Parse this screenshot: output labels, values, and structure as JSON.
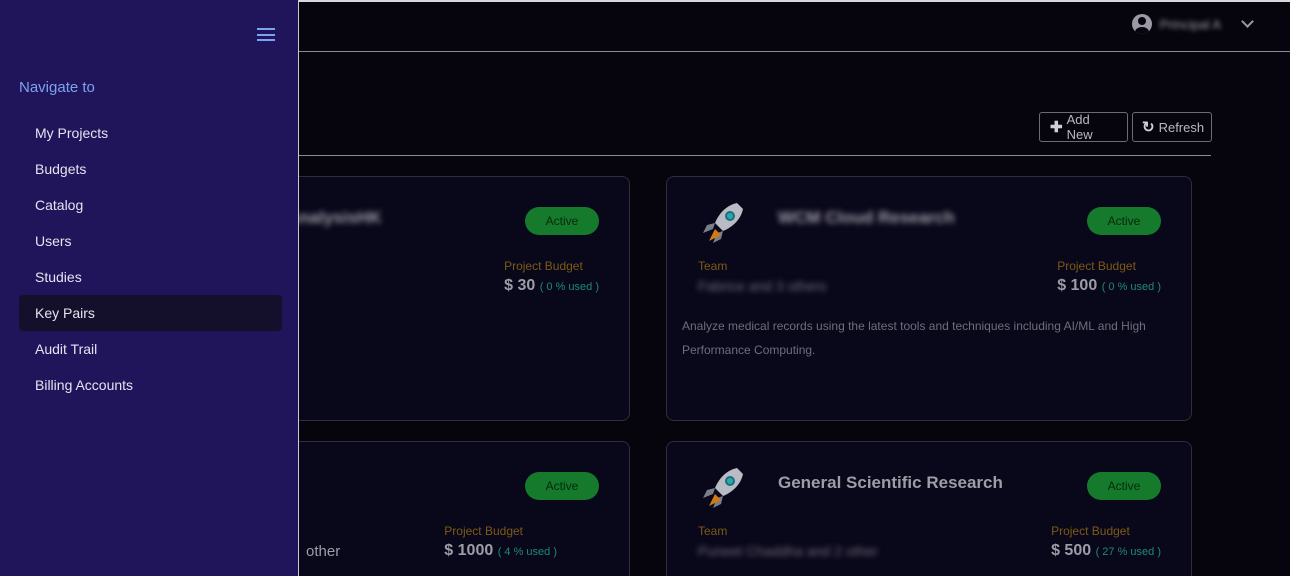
{
  "header": {
    "user_name": "Principal A"
  },
  "toolbar": {
    "add_label": "Add New",
    "refresh_label": "Refresh"
  },
  "sidebar": {
    "title": "Navigate to",
    "items": [
      {
        "label": "My Projects"
      },
      {
        "label": "Budgets"
      },
      {
        "label": "Catalog"
      },
      {
        "label": "Users"
      },
      {
        "label": "Studies"
      },
      {
        "label": "Key Pairs",
        "active": true
      },
      {
        "label": "Audit Trail"
      },
      {
        "label": "Billing Accounts"
      }
    ]
  },
  "projects": [
    {
      "title": "AnalysisHK",
      "status": "Active",
      "budget_label": "Project Budget",
      "budget": "$ 30",
      "used": "( 0 % used )"
    },
    {
      "title": "WCM Cloud Research",
      "status": "Active",
      "team_label": "Team",
      "team": "Fabrice and 3 others",
      "budget_label": "Project Budget",
      "budget": "$ 100",
      "used": "( 0 % used )",
      "description": "Analyze medical records using the latest tools and techniques including AI/ML and High Performance Computing."
    },
    {
      "team_partial": "other",
      "status": "Active",
      "budget_label": "Project Budget",
      "budget": "$ 1000",
      "used": "( 4 % used )"
    },
    {
      "title": "General Scientific Research",
      "status": "Active",
      "team_label": "Team",
      "team": "Puneet Chaddha and 2 other",
      "budget_label": "Project Budget",
      "budget": "$ 500",
      "used": "( 27 % used )"
    }
  ],
  "colors": {
    "sidebar_bg": "#20145a",
    "nav_accent": "#7ca3ef",
    "active_badge": "#157a2b",
    "budget_label": "#7d5a14",
    "used_text": "#1f8a76"
  }
}
